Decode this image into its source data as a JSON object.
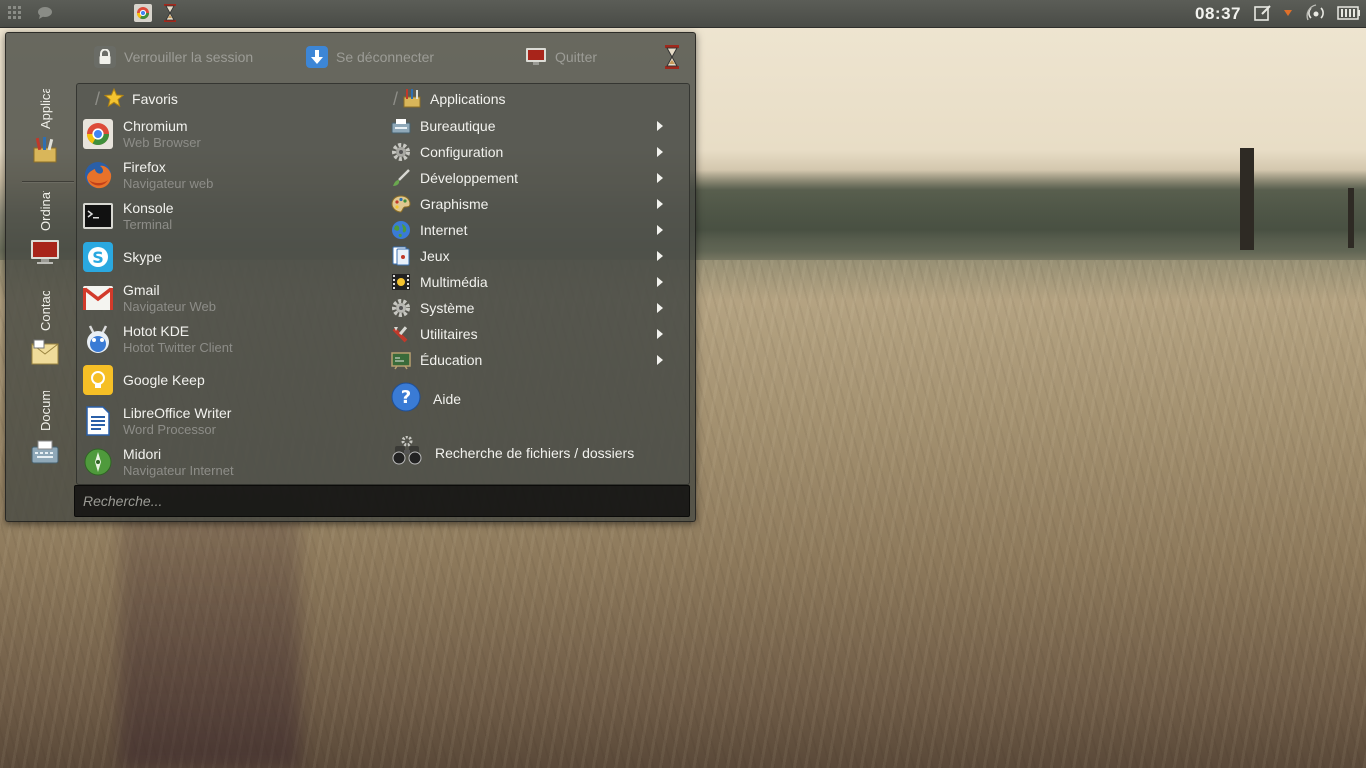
{
  "panel": {
    "clock": "08:37",
    "icons": [
      "app-grid-icon",
      "chat-bubble-icon",
      "chromium-taskbar-icon",
      "hourglass-icon",
      "edit-note-icon",
      "update-notifier-icon",
      "network-icon",
      "battery-icon"
    ]
  },
  "menu": {
    "top": {
      "lock_label": "Verrouiller la session",
      "logout_label": "Se déconnecter",
      "quit_label": "Quitter"
    },
    "side_tabs": [
      {
        "label": "Applications",
        "icon": "applications-icon"
      },
      {
        "label": "Ordinateur",
        "icon": "computer-monitor-icon"
      },
      {
        "label": "Contacts",
        "icon": "contacts-icon"
      },
      {
        "label": "Documents",
        "icon": "typewriter-icon"
      }
    ],
    "favorites_header": "Favoris",
    "applications_header": "Applications",
    "favorites": [
      {
        "name": "Chromium",
        "desc": "Web Browser",
        "icon": "chromium-icon"
      },
      {
        "name": "Firefox",
        "desc": "Navigateur web",
        "icon": "firefox-icon"
      },
      {
        "name": "Konsole",
        "desc": "Terminal",
        "icon": "terminal-icon"
      },
      {
        "name": "Skype",
        "desc": "",
        "icon": "skype-icon"
      },
      {
        "name": "Gmail",
        "desc": "Navigateur Web",
        "icon": "gmail-icon"
      },
      {
        "name": "Hotot KDE",
        "desc": "Hotot Twitter Client",
        "icon": "hotot-icon"
      },
      {
        "name": "Google Keep",
        "desc": "",
        "icon": "google-keep-icon"
      },
      {
        "name": "LibreOffice Writer",
        "desc": "Word Processor",
        "icon": "writer-icon"
      },
      {
        "name": "Midori",
        "desc": "Navigateur Internet",
        "icon": "midori-icon"
      }
    ],
    "categories": [
      {
        "label": "Bureautique",
        "icon": "typewriter-icon"
      },
      {
        "label": "Configuration",
        "icon": "gear-icon"
      },
      {
        "label": "Développement",
        "icon": "brush-icon"
      },
      {
        "label": "Graphisme",
        "icon": "palette-icon"
      },
      {
        "label": "Internet",
        "icon": "globe-icon"
      },
      {
        "label": "Jeux",
        "icon": "cards-icon"
      },
      {
        "label": "Multimédia",
        "icon": "film-icon"
      },
      {
        "label": "Système",
        "icon": "system-gear-icon"
      },
      {
        "label": "Utilitaires",
        "icon": "tools-icon"
      },
      {
        "label": "Éducation",
        "icon": "chalkboard-icon"
      }
    ],
    "help_label": "Aide",
    "search_files_label": "Recherche de fichiers / dossiers",
    "search_placeholder": "Recherche..."
  },
  "colors": {
    "panel_bg": "#4f514c",
    "menu_bg": "#464842",
    "text_primary": "#f2f2ee",
    "text_secondary": "#8d8d88",
    "accent_red": "#b1261c"
  }
}
